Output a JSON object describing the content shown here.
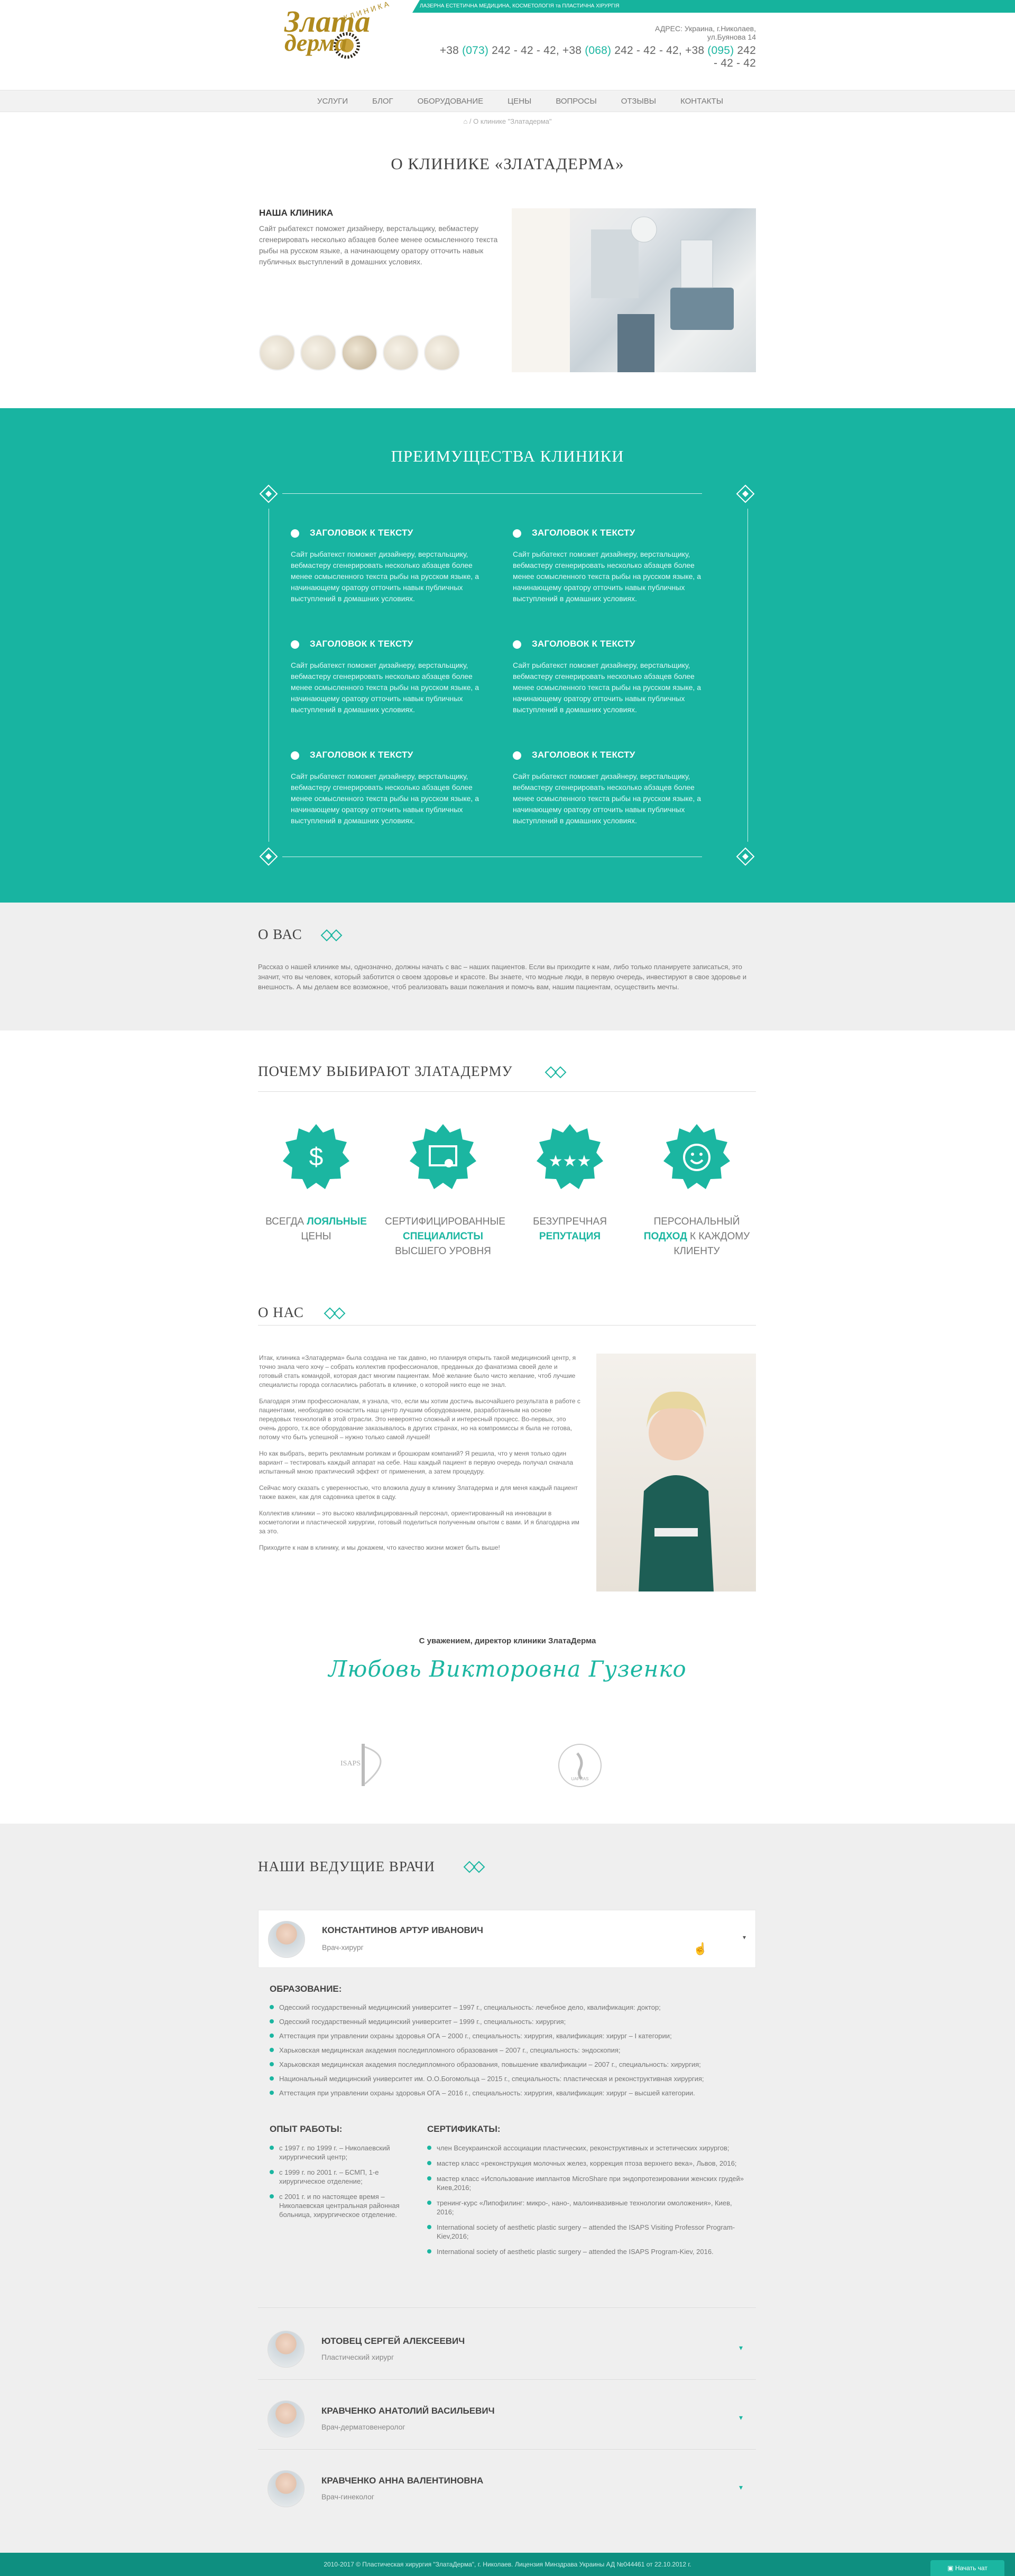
{
  "header": {
    "tagline": "ЛАЗЕРНА ЕСТЕТИЧНА МЕДИЦИНА, КОСМЕТОЛОГІЯ та ПЛАСТИЧНА ХІРУРГІЯ",
    "logo_main": "Злата",
    "logo_sub": "дерма",
    "logo_tag": "КЛИНИКА",
    "address": "АДРЕС: Украина, г.Николаев, ул.Буянова 14",
    "phones": [
      {
        "prefix": "+38 ",
        "code": "(073)",
        "num": " 242 - 42 - 42, "
      },
      {
        "prefix": "+38 ",
        "code": "(068)",
        "num": " 242 - 42 - 42, "
      },
      {
        "prefix": "+38 ",
        "code": "(095)",
        "num": " 242 - 42 - 42"
      }
    ]
  },
  "nav": {
    "items": [
      "Услуги",
      "Блог",
      "Оборудование",
      "Цены",
      "Вопросы",
      "Отзывы",
      "Контакты"
    ]
  },
  "breadcrumb": {
    "current": " / О клинике \"Златадерма\""
  },
  "about_clinic": {
    "title": "О КЛИНИКЕ «ЗЛАТАДЕРМА»",
    "subtitle": "НАША КЛИНИКА",
    "text": "Сайт рыбатекст поможет дизайнеру, верстальщику, вебмастеру сгенерировать несколько абзацев более менее осмысленного текста рыбы на русском языке, а начинающему оратору отточить навык публичных выступлений в домашних условиях."
  },
  "advantages": {
    "title": "ПРЕИМУЩЕСТВА КЛИНИКИ",
    "items": [
      {
        "heading": "ЗАГОЛОВОК К ТЕКСТУ",
        "text": "Сайт рыбатекст поможет дизайнеру, верстальщику, вебмастеру сгенерировать несколько абзацев более менее осмысленного текста рыбы на русском языке, а начинающему оратору отточить навык публичных выступлений в домашних условиях."
      },
      {
        "heading": "ЗАГОЛОВОК К ТЕКСТУ",
        "text": "Сайт рыбатекст поможет дизайнеру, верстальщику, вебмастеру сгенерировать несколько абзацев более менее осмысленного текста рыбы на русском языке, а начинающему оратору отточить навык публичных выступлений в домашних условиях."
      },
      {
        "heading": "ЗАГОЛОВОК К ТЕКСТУ",
        "text": "Сайт рыбатекст поможет дизайнеру, верстальщику, вебмастеру сгенерировать несколько абзацев более менее осмысленного текста рыбы на русском языке, а начинающему оратору отточить навык публичных выступлений в домашних условиях."
      },
      {
        "heading": "ЗАГОЛОВОК К ТЕКСТУ",
        "text": "Сайт рыбатекст поможет дизайнеру, верстальщику, вебмастеру сгенерировать несколько абзацев более менее осмысленного текста рыбы на русском языке, а начинающему оратору отточить навык публичных выступлений в домашних условиях."
      },
      {
        "heading": "ЗАГОЛОВОК К ТЕКСТУ",
        "text": "Сайт рыбатекст поможет дизайнеру, верстальщику, вебмастеру сгенерировать несколько абзацев более менее осмысленного текста рыбы на русском языке, а начинающему оратору отточить навык публичных выступлений в домашних условиях."
      },
      {
        "heading": "ЗАГОЛОВОК К ТЕКСТУ",
        "text": "Сайт рыбатекст поможет дизайнеру, верстальщику, вебмастеру сгенерировать несколько абзацев более менее осмысленного текста рыбы на русском языке, а начинающему оратору отточить навык публичных выступлений в домашних условиях."
      }
    ]
  },
  "about_you": {
    "title": "О ВАС",
    "text": "Рассказ о нашей клинике мы, однозначно, должны начать с вас – наших пациентов. Если вы приходите к нам, либо только планируете записаться, это значит, что вы человек, который заботится о своем здоровье и красоте. Вы знаете, что модные люди, в первую очередь, инвестируют в свое здоровье и внешность. А мы делаем все возможное, чтоб реализовать ваши пожелания и помочь вам, нашим пациентам, осуществить мечты."
  },
  "why": {
    "title": "ПОЧЕМУ ВЫБИРАЮТ ЗЛАТАДЕРМУ",
    "items": [
      {
        "pre": "ВСЕГДА ",
        "hi": "ЛОЯЛЬНЫЕ",
        "post": " ЦЕНЫ",
        "icon": "dollar-icon"
      },
      {
        "pre": "СЕРТИФИЦИРОВАННЫЕ ",
        "hi": "СПЕЦИАЛИСТЫ",
        "post": " ВЫСШЕГО УРОВНЯ",
        "icon": "certificate-icon"
      },
      {
        "pre": "БЕЗУПРЕЧНАЯ ",
        "hi": "РЕПУТАЦИЯ",
        "post": "",
        "icon": "stars-icon"
      },
      {
        "pre": "ПЕРСОНАЛЬНЫЙ ",
        "hi": "ПОДХОД",
        "post": " К КАЖДОМУ КЛИЕНТУ",
        "icon": "smile-icon"
      }
    ]
  },
  "about_us": {
    "title": "О НАС",
    "paragraphs": [
      "Итак, клиника «Златадерма» была создана не так давно, но планируя открыть такой медицинский центр, я точно знала чего хочу – собрать коллектив профессионалов, преданных до фанатизма своей деле и готовый стать командой, которая даст многим пациентам. Моё желание было чисто желание, чтоб лучшие специалисты города согласились работать в клинике, о которой никто еще не знал.",
      "Благодаря этим профессионалам, я узнала, что, если мы хотим достичь высочайшего результата в работе с пациентами, необходимо оснастить наш центр лучшим оборудованием, разработанным на основе передовых технологий в этой отрасли. Это невероятно сложный и интересный процесс. Во-первых, это очень дорого, т.к.все оборудование заказывалось в других странах, но на компромиссы я была не готова, потому что быть успешной – нужно только самой лучшей!",
      "Но как выбрать, верить рекламным роликам и брошюрам компаний? Я решила, что у меня только один вариант – тестировать каждый аппарат на себе. Наш каждый пациент в первую очередь получал сначала испытанный мною практический эффект от применения, а затем процедуру.",
      "Сейчас могу сказать с уверенностью, что вложила душу в клинику Златадерма и для меня каждый пациент также важен, как для садовника цветок в саду.",
      "Коллектив клиники – это высоко квалифицированный персонал, ориентированный на инновации в косметологии и пластической хирургии, готовый поделиться полученным опытом с вами. И я благодарна им за это.",
      "Приходите к нам в клинику, и мы докажем, что качество жизни может быть выше!"
    ],
    "regards": "С уважением, директор клиники ЗлатаДерма",
    "signature": "Любовь Викторовна Гузенко"
  },
  "logos": {
    "left": "ISAPS",
    "right": "UAPRAS"
  },
  "doctors": {
    "title": "НАШИ ВЕДУЩИЕ ВРАЧИ",
    "education_title": "ОБРАЗОВАНИЕ:",
    "experience_title": "ОПЫТ РАБОТЫ:",
    "certificates_title": "СЕРТИФИКАТЫ:",
    "expanded": {
      "name": "КОНСТАНТИНОВ АРТУР ИВАНОВИЧ",
      "profession": "Врач-хирург",
      "education": [
        "Одесский государственный медицинский университет – 1997 г., специальность: лечебное дело, квалификация: доктор;",
        "Одесский государственный медицинский университет – 1999 г., специальность: хирургия;",
        "Аттестация при управлении охраны здоровья ОГА – 2000 г., специальность: хирургия, квалификация: хирург – I категории;",
        "Харьковская медицинская академия последипломного образования – 2007 г., специальность: эндоскопия;",
        "Харьковская медицинская академия последипломного образования, повышение квалификации – 2007 г., специальность: хирургия;",
        "Национальный медицинский университет им. О.О.Богомольца – 2015 г., специальность: пластическая и реконструктивная хирургия;",
        "Аттестация при управлении охраны здоровья ОГА – 2016 г., специальность: хирургия, квалификация: хирург – высшей категории."
      ],
      "experience": [
        "с 1997 г. по 1999 г. – Николаевский хирургический центр;",
        "с 1999 г. по 2001 г. – БСМП, 1-е хирургическое отделение;",
        "с 2001 г. и по настоящее время – Николаевская центральная районная больница, хирургическое отделение."
      ],
      "certificates": [
        "член Всеукраинской ассоциации пластических, реконструктивных и эстетических хирургов;",
        "мастер класс «реконструкция молочных желез, коррекция птоза верхнего века», Львов, 2016;",
        "мастер класс «Использование имплантов MicroShare при эндопротезировании женских грудей» Киев,2016;",
        "тренинг-курс «Липофилинг: микро-, нано-, малоинвазивные технологии омоложения», Киев, 2016;",
        "International society of aesthetic plastic surgery – attended the ISAPS Visiting Professor Program-Kiev,2016;",
        "International society of aesthetic plastic surgery – attended the ISAPS Program-Kiev, 2016."
      ]
    },
    "collapsed": [
      {
        "name": "ЮТОВЕЦ СЕРГЕЙ АЛЕКСЕЕВИЧ",
        "profession": "Пластический хирург"
      },
      {
        "name": "КРАВЧЕНКО АНАТОЛИЙ ВАСИЛЬЕВИЧ",
        "profession": "Врач-дерматовенеролог"
      },
      {
        "name": "КРАВЧЕНКО АННА ВАЛЕНТИНОВНА",
        "profession": "Врач-гинеколог"
      }
    ]
  },
  "footer": {
    "text": "2010-2017 © Пластическая хирургия \"ЗлатаДерма\", г. Николаев. Лицензия Минздрава Украины АД №044461 от 22.10.2012 г."
  },
  "chat": {
    "label": "Начать чат"
  },
  "colors": {
    "accent": "#1bb6a1",
    "dark_accent": "#0e8f80",
    "light_gray": "#efefef"
  }
}
